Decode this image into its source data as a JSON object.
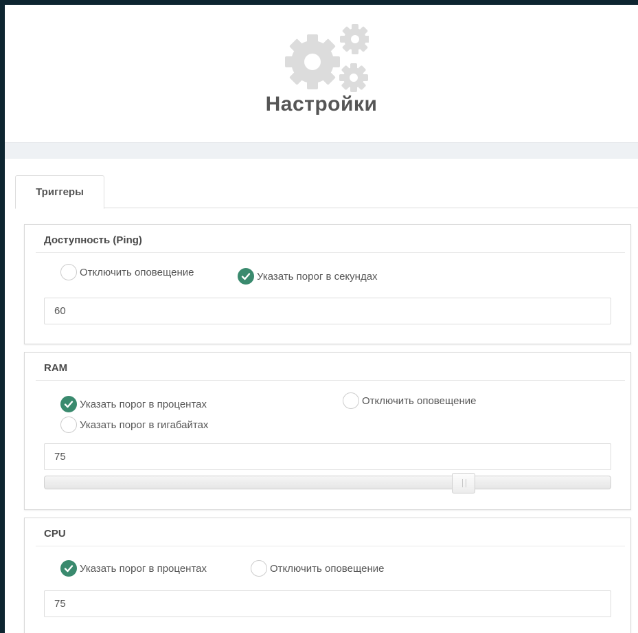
{
  "header": {
    "icon": "gears-icon",
    "title": "Настройки"
  },
  "tabs": [
    {
      "label": "Триггеры",
      "active": true
    }
  ],
  "panels": {
    "ping": {
      "title": "Доступность (Ping)",
      "options": [
        {
          "label": "Отключить оповещение",
          "checked": false
        },
        {
          "label": "Указать порог в секундах",
          "checked": true
        }
      ],
      "value": "60"
    },
    "ram": {
      "title": "RAM",
      "options": [
        {
          "label": "Указать порог в процентах",
          "checked": true
        },
        {
          "label": "Указать порог в гигабайтах",
          "checked": false
        },
        {
          "label": "Отключить оповещение",
          "checked": false
        }
      ],
      "value": "75",
      "slider_percent": 75
    },
    "cpu": {
      "title": "CPU",
      "options": [
        {
          "label": "Указать порог в процентах",
          "checked": true
        },
        {
          "label": "Отключить оповещение",
          "checked": false
        }
      ],
      "value": "75"
    }
  },
  "colors": {
    "accent": "#3a8a6e",
    "background": "#0d2530",
    "icon_gray": "#dcdcdc"
  }
}
